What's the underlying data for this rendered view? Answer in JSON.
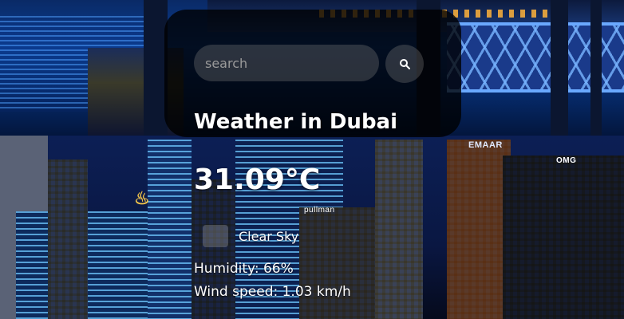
{
  "search": {
    "placeholder": "search",
    "value": ""
  },
  "weather": {
    "title": "Weather in Dubai",
    "temperature": "31.09°C",
    "description": "Clear Sky",
    "humidity": "Humidity: 66%",
    "wind": "Wind speed: 1.03 km/h"
  },
  "background": {
    "signs": [
      "EMAAR",
      "pullman",
      "OMG"
    ]
  },
  "colors": {
    "card": "#000000",
    "text": "#ffffff",
    "input": "#787878"
  },
  "icons": {
    "search_button": "search-icon",
    "weather": "weather-icon"
  }
}
